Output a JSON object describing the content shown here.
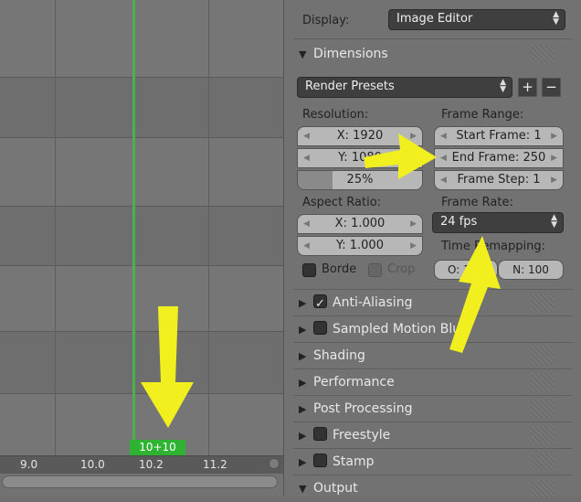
{
  "timeline": {
    "ruler_ticks": [
      "9.0",
      "10.0",
      "10.2",
      "11.2"
    ],
    "current_frame_badge": "10+10"
  },
  "properties": {
    "display_label": "Display:",
    "display_value": "Image Editor",
    "dimensions_header": "Dimensions",
    "render_presets": "Render Presets",
    "resolution_label": "Resolution:",
    "resolution_x": "X: 1920",
    "resolution_y": "Y: 1080",
    "resolution_pct": "25%",
    "frame_range_label": "Frame Range:",
    "start_frame": "Start Frame: 1",
    "end_frame": "End Frame: 250",
    "frame_step": "Frame Step: 1",
    "aspect_label": "Aspect Ratio:",
    "aspect_x": "X: 1.000",
    "aspect_y": "Y: 1.000",
    "frame_rate_label": "Frame Rate:",
    "frame_rate_value": "24 fps",
    "time_remap_label": "Time Remapping:",
    "time_remap_old": "O: 100",
    "time_remap_new": "N: 100",
    "border_label": "Borde",
    "crop_label": "Crop",
    "panels": [
      {
        "label": "Anti-Aliasing",
        "checkbox": true,
        "checked": true
      },
      {
        "label": "Sampled Motion Blur",
        "checkbox": true,
        "checked": false
      },
      {
        "label": "Shading",
        "checkbox": false
      },
      {
        "label": "Performance",
        "checkbox": false
      },
      {
        "label": "Post Processing",
        "checkbox": false
      },
      {
        "label": "Freestyle",
        "checkbox": true,
        "checked": false
      },
      {
        "label": "Stamp",
        "checkbox": true,
        "checked": false
      },
      {
        "label": "Output",
        "checkbox": false,
        "expanded": true
      }
    ]
  },
  "colors": {
    "accent_green": "#2fb333",
    "annotation_arrow": "#f2ef1f"
  }
}
